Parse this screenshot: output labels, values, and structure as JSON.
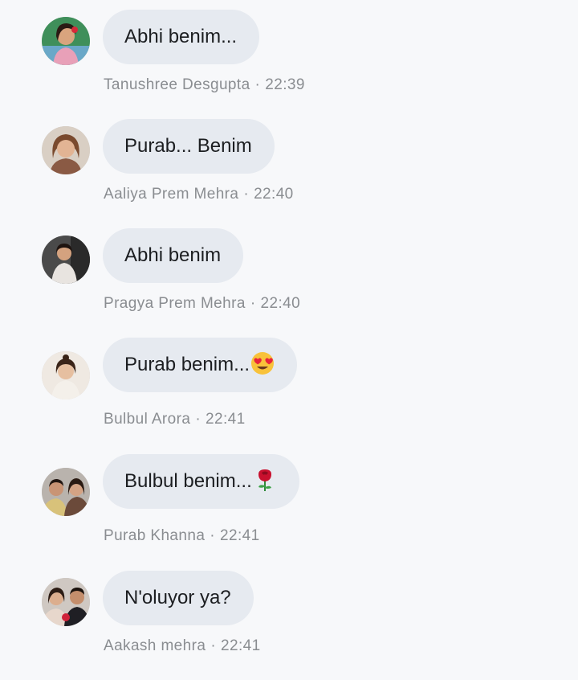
{
  "colors": {
    "background": "#f7f8fa",
    "bubble": "#e6eaf0",
    "message_text": "#1c1e21",
    "meta_text": "#8a8d91"
  },
  "messages": [
    {
      "author": "Tanushree Desgupta",
      "time": "22:39",
      "text": "Abhi benim...",
      "emoji": "",
      "avatar_icon": "avatar-photo-icon"
    },
    {
      "author": "Aaliya Prem Mehra",
      "time": "22:40",
      "text": "Purab... Benim",
      "emoji": "",
      "avatar_icon": "avatar-photo-icon"
    },
    {
      "author": "Pragya Prem Mehra",
      "time": "22:40",
      "text": "Abhi benim",
      "emoji": "",
      "avatar_icon": "avatar-photo-icon"
    },
    {
      "author": "Bulbul Arora",
      "time": "22:41",
      "text": "Purab benim...",
      "emoji": "heart-eyes-emoji",
      "avatar_icon": "avatar-photo-icon"
    },
    {
      "author": "Purab Khanna",
      "time": "22:41",
      "text": "Bulbul benim...",
      "emoji": "rose-emoji",
      "avatar_icon": "avatar-photo-icon"
    },
    {
      "author": "Aakash mehra",
      "time": "22:41",
      "text": "N'oluyor ya?",
      "emoji": "",
      "avatar_icon": "avatar-photo-icon"
    }
  ],
  "separator": "·"
}
